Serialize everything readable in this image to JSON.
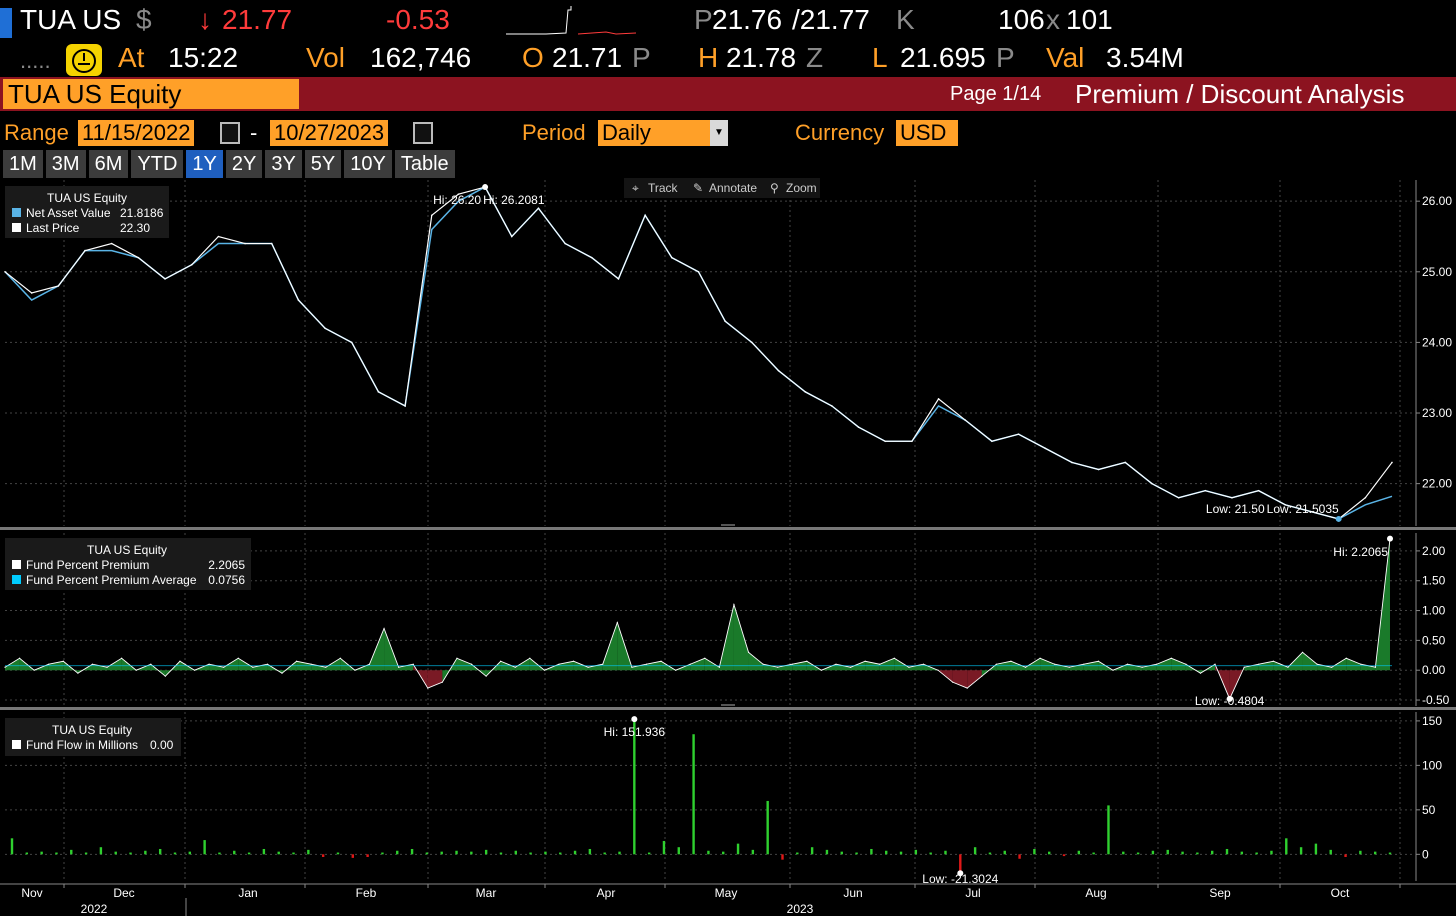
{
  "ticker": {
    "symbol": "TUA US",
    "currency_sign": "$",
    "arrow": "↓",
    "last": "21.77",
    "change": "-0.53",
    "bid_ask_p": "P",
    "bid": "21.76",
    "ask": "/21.77",
    "ask_suffix": "K",
    "size_bid": "106",
    "size_x": "x",
    "size_ask": "101",
    "dots": ".....",
    "at_label": "At",
    "time": "15:22",
    "vol_label": "Vol",
    "vol": "162,746",
    "open_label": "O",
    "open": "21.71",
    "open_suffix": "P",
    "high_label": "H",
    "high": "21.78",
    "high_suffix": "Z",
    "low_label": "L",
    "low": "21.695",
    "low_suffix": "P",
    "val_label": "Val",
    "val": "3.54M"
  },
  "header": {
    "security": "TUA US Equity",
    "page": "Page 1/14",
    "title": "Premium / Discount Analysis"
  },
  "controls": {
    "range_label": "Range",
    "start": "11/15/2022",
    "dash": "-",
    "end": "10/27/2023",
    "period_label": "Period",
    "period": "Daily",
    "currency_label": "Currency",
    "currency": "USD"
  },
  "range_buttons": [
    "1M",
    "3M",
    "6M",
    "YTD",
    "1Y",
    "2Y",
    "3Y",
    "5Y",
    "10Y",
    "Table"
  ],
  "active_range": "1Y",
  "toolbar": {
    "track": "Track",
    "annotate": "Annotate",
    "zoom": "Zoom"
  },
  "colors": {
    "nav": "#5ab4e6",
    "price": "#ffffff",
    "premium_pos": "#1a7a2a",
    "premium_neg": "#7a1a25",
    "flow_pos": "#2fd02f",
    "flow_neg": "#e01818",
    "orange": "#ffa028",
    "loss": "#ff3b3b"
  },
  "chart_data": [
    {
      "type": "line",
      "legend_title": "TUA US Equity",
      "series": [
        {
          "name": "Net Asset Value",
          "last": "21.8186"
        },
        {
          "name": "Last Price",
          "last": "22.30"
        }
      ],
      "x": [
        "2022-11-15",
        "2022-11-22",
        "2022-11-29",
        "2022-12-06",
        "2022-12-13",
        "2022-12-20",
        "2022-12-27",
        "2023-01-03",
        "2023-01-10",
        "2023-01-17",
        "2023-01-24",
        "2023-01-31",
        "2023-02-07",
        "2023-02-14",
        "2023-02-21",
        "2023-02-28",
        "2023-03-03",
        "2023-03-07",
        "2023-03-10",
        "2023-03-14",
        "2023-03-20",
        "2023-03-27",
        "2023-04-03",
        "2023-04-10",
        "2023-04-17",
        "2023-04-24",
        "2023-05-01",
        "2023-05-08",
        "2023-05-15",
        "2023-05-22",
        "2023-05-29",
        "2023-06-05",
        "2023-06-12",
        "2023-06-19",
        "2023-06-26",
        "2023-07-03",
        "2023-07-10",
        "2023-07-17",
        "2023-07-24",
        "2023-07-31",
        "2023-08-07",
        "2023-08-14",
        "2023-08-21",
        "2023-08-28",
        "2023-09-04",
        "2023-09-11",
        "2023-09-18",
        "2023-09-25",
        "2023-10-02",
        "2023-10-09",
        "2023-10-16",
        "2023-10-23",
        "2023-10-27"
      ],
      "price": [
        25.0,
        24.7,
        24.8,
        25.3,
        25.4,
        25.2,
        24.9,
        25.1,
        25.5,
        25.4,
        25.4,
        24.6,
        24.2,
        24.0,
        23.3,
        23.1,
        25.8,
        26.1,
        26.2,
        25.5,
        25.9,
        25.4,
        25.2,
        24.9,
        25.8,
        25.2,
        25.0,
        24.3,
        24.0,
        23.6,
        23.3,
        23.1,
        22.8,
        22.6,
        22.6,
        23.2,
        22.9,
        22.6,
        22.7,
        22.5,
        22.3,
        22.2,
        22.3,
        22.0,
        21.8,
        21.9,
        21.8,
        21.9,
        21.7,
        21.6,
        21.5,
        21.8,
        22.3
      ],
      "nav": [
        25.0,
        24.6,
        24.8,
        25.3,
        25.3,
        25.2,
        24.9,
        25.1,
        25.4,
        25.4,
        25.4,
        24.6,
        24.2,
        24.0,
        23.3,
        23.1,
        25.6,
        26.0,
        26.2,
        25.5,
        25.9,
        25.4,
        25.2,
        24.9,
        25.8,
        25.2,
        25.0,
        24.3,
        24.0,
        23.6,
        23.3,
        23.1,
        22.8,
        22.6,
        22.6,
        23.1,
        22.9,
        22.6,
        22.7,
        22.5,
        22.3,
        22.2,
        22.3,
        22.0,
        21.8,
        21.9,
        21.8,
        21.9,
        21.7,
        21.6,
        21.5,
        21.7,
        21.82
      ],
      "ylim": [
        21.4,
        26.3
      ],
      "yticks": [
        "22.00",
        "23.00",
        "24.00",
        "25.00",
        "26.00"
      ],
      "hi_price_label": "Hi: 26.20",
      "hi_nav_label": "Hi: 26.2081",
      "low_price_label": "Low: 21.50",
      "low_nav_label": "Low: 21.5035"
    },
    {
      "type": "area",
      "legend_title": "TUA US Equity",
      "series": [
        {
          "name": "Fund Percent Premium",
          "last": "2.2065"
        },
        {
          "name": "Fund Percent Premium Average",
          "last": "0.0756"
        }
      ],
      "values": [
        0.05,
        0.2,
        0.0,
        0.1,
        0.15,
        -0.05,
        0.1,
        0.05,
        0.2,
        0.0,
        0.1,
        -0.1,
        0.15,
        0.0,
        0.1,
        0.05,
        0.2,
        0.05,
        0.1,
        -0.05,
        0.15,
        0.1,
        0.05,
        0.2,
        0.0,
        0.1,
        0.7,
        0.05,
        0.1,
        -0.3,
        -0.2,
        0.2,
        0.1,
        -0.1,
        0.15,
        0.05,
        0.2,
        0.0,
        0.1,
        0.15,
        0.05,
        0.1,
        0.8,
        0.05,
        0.1,
        0.15,
        0.0,
        0.1,
        0.2,
        0.05,
        1.1,
        0.3,
        0.1,
        0.05,
        0.1,
        0.15,
        0.0,
        0.1,
        0.05,
        0.15,
        0.1,
        0.2,
        0.05,
        0.1,
        0.0,
        -0.2,
        -0.3,
        -0.1,
        0.1,
        0.15,
        0.05,
        0.2,
        0.1,
        0.05,
        0.1,
        0.15,
        0.0,
        0.1,
        0.05,
        0.1,
        0.2,
        0.1,
        -0.05,
        0.1,
        -0.48,
        0.05,
        0.1,
        0.15,
        0.05,
        0.3,
        0.1,
        0.05,
        0.2,
        0.1,
        0.05,
        2.2065
      ],
      "ylim": [
        -0.6,
        2.3
      ],
      "yticks": [
        "-0.50",
        "0.00",
        "0.50",
        "1.00",
        "1.50",
        "2.00"
      ],
      "hi_label": "Hi: 2.2065",
      "low_label": "Low: -0.4804"
    },
    {
      "type": "bar",
      "legend_title": "TUA US Equity",
      "series": [
        {
          "name": "Fund Flow in Millions",
          "last": "0.00"
        }
      ],
      "values": [
        18,
        2,
        3,
        2,
        5,
        2,
        8,
        3,
        2,
        4,
        6,
        2,
        3,
        16,
        2,
        4,
        2,
        6,
        3,
        2,
        5,
        -3,
        2,
        -4,
        -3,
        2,
        4,
        6,
        2,
        3,
        4,
        3,
        5,
        2,
        4,
        2,
        3,
        2,
        4,
        6,
        2,
        3,
        151.936,
        2,
        15,
        8,
        135,
        4,
        3,
        12,
        5,
        60,
        -6,
        2,
        8,
        5,
        3,
        2,
        6,
        4,
        3,
        5,
        2,
        4,
        -21.3024,
        8,
        2,
        4,
        -5,
        6,
        3,
        -2,
        4,
        2,
        55,
        3,
        2,
        4,
        5,
        3,
        2,
        4,
        6,
        3,
        2,
        4,
        18,
        8,
        12,
        5,
        -3,
        4,
        3,
        2
      ],
      "ylim": [
        -30,
        160
      ],
      "yticks": [
        "0",
        "50",
        "100",
        "150"
      ],
      "hi_label": "Hi: 151.936",
      "low_label": "Low: -21.3024"
    }
  ],
  "x_axis": {
    "months": [
      "Nov",
      "Dec",
      "Jan",
      "Feb",
      "Mar",
      "Apr",
      "May",
      "Jun",
      "Jul",
      "Aug",
      "Sep",
      "Oct"
    ],
    "years": [
      "2022",
      "2023"
    ]
  }
}
